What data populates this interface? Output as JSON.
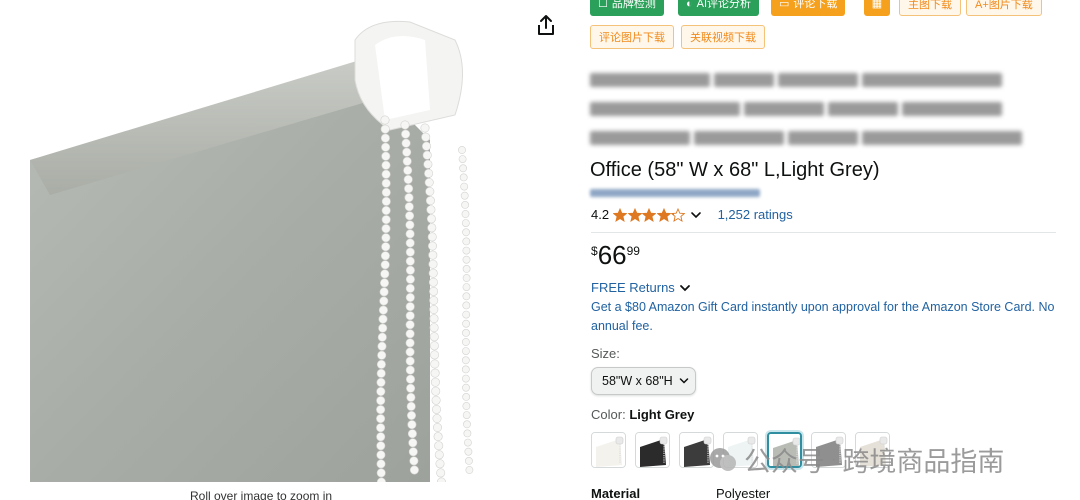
{
  "plugin_toolbar": {
    "buttons": [
      {
        "label": "品牌检测",
        "icon": "checkbox-icon"
      },
      {
        "label": "AI评论分析",
        "icon": "ai-icon"
      },
      {
        "label": "评论下载",
        "icon": "comment-icon"
      },
      {
        "label": "",
        "icon": "grid-icon"
      },
      {
        "label": "主图下载",
        "icon": ""
      },
      {
        "label": "A+图片下载",
        "icon": ""
      },
      {
        "label": "评论图片下载",
        "icon": ""
      },
      {
        "label": "关联视频下载",
        "icon": ""
      }
    ]
  },
  "product": {
    "title_visible_line": "Office (58\" W x 68\" L,Light Grey)",
    "rating": "4.2",
    "stars_value": 4.2,
    "rating_count": "1,252 ratings",
    "price": {
      "symbol": "$",
      "whole": "66",
      "fraction": "99"
    },
    "returns_label": "FREE Returns",
    "offer_text": "Get a $80 Amazon Gift Card instantly upon approval for the Amazon Store Card. No annual fee.",
    "size_label": "Size:",
    "size_selected": "58\"W x 68\"H",
    "color_label": "Color:",
    "color_selected": "Light Grey",
    "swatch_count": 7,
    "swatches": [
      {
        "name": "white",
        "color": "#f3f2ec"
      },
      {
        "name": "black",
        "color": "#2b2b2b"
      },
      {
        "name": "dark-grey",
        "color": "#3c3c3c"
      },
      {
        "name": "white-2",
        "color": "#eef3f4"
      },
      {
        "name": "light-grey",
        "color": "#b9bcb5",
        "selected": true
      },
      {
        "name": "grey",
        "color": "#8f8f8f"
      },
      {
        "name": "beige",
        "color": "#e6e1d8"
      }
    ],
    "material_label": "Material",
    "material_value": "Polyester"
  },
  "image": {
    "zoom_hint": "Roll over image to zoom in"
  },
  "watermark": {
    "left": "公众号",
    "sep": "·",
    "right": "跨境商品指南"
  },
  "colors": {
    "link": "#2162a1",
    "star": "#de7921",
    "plugin_green": "#2ba05a",
    "plugin_orange": "#f5a11d"
  }
}
